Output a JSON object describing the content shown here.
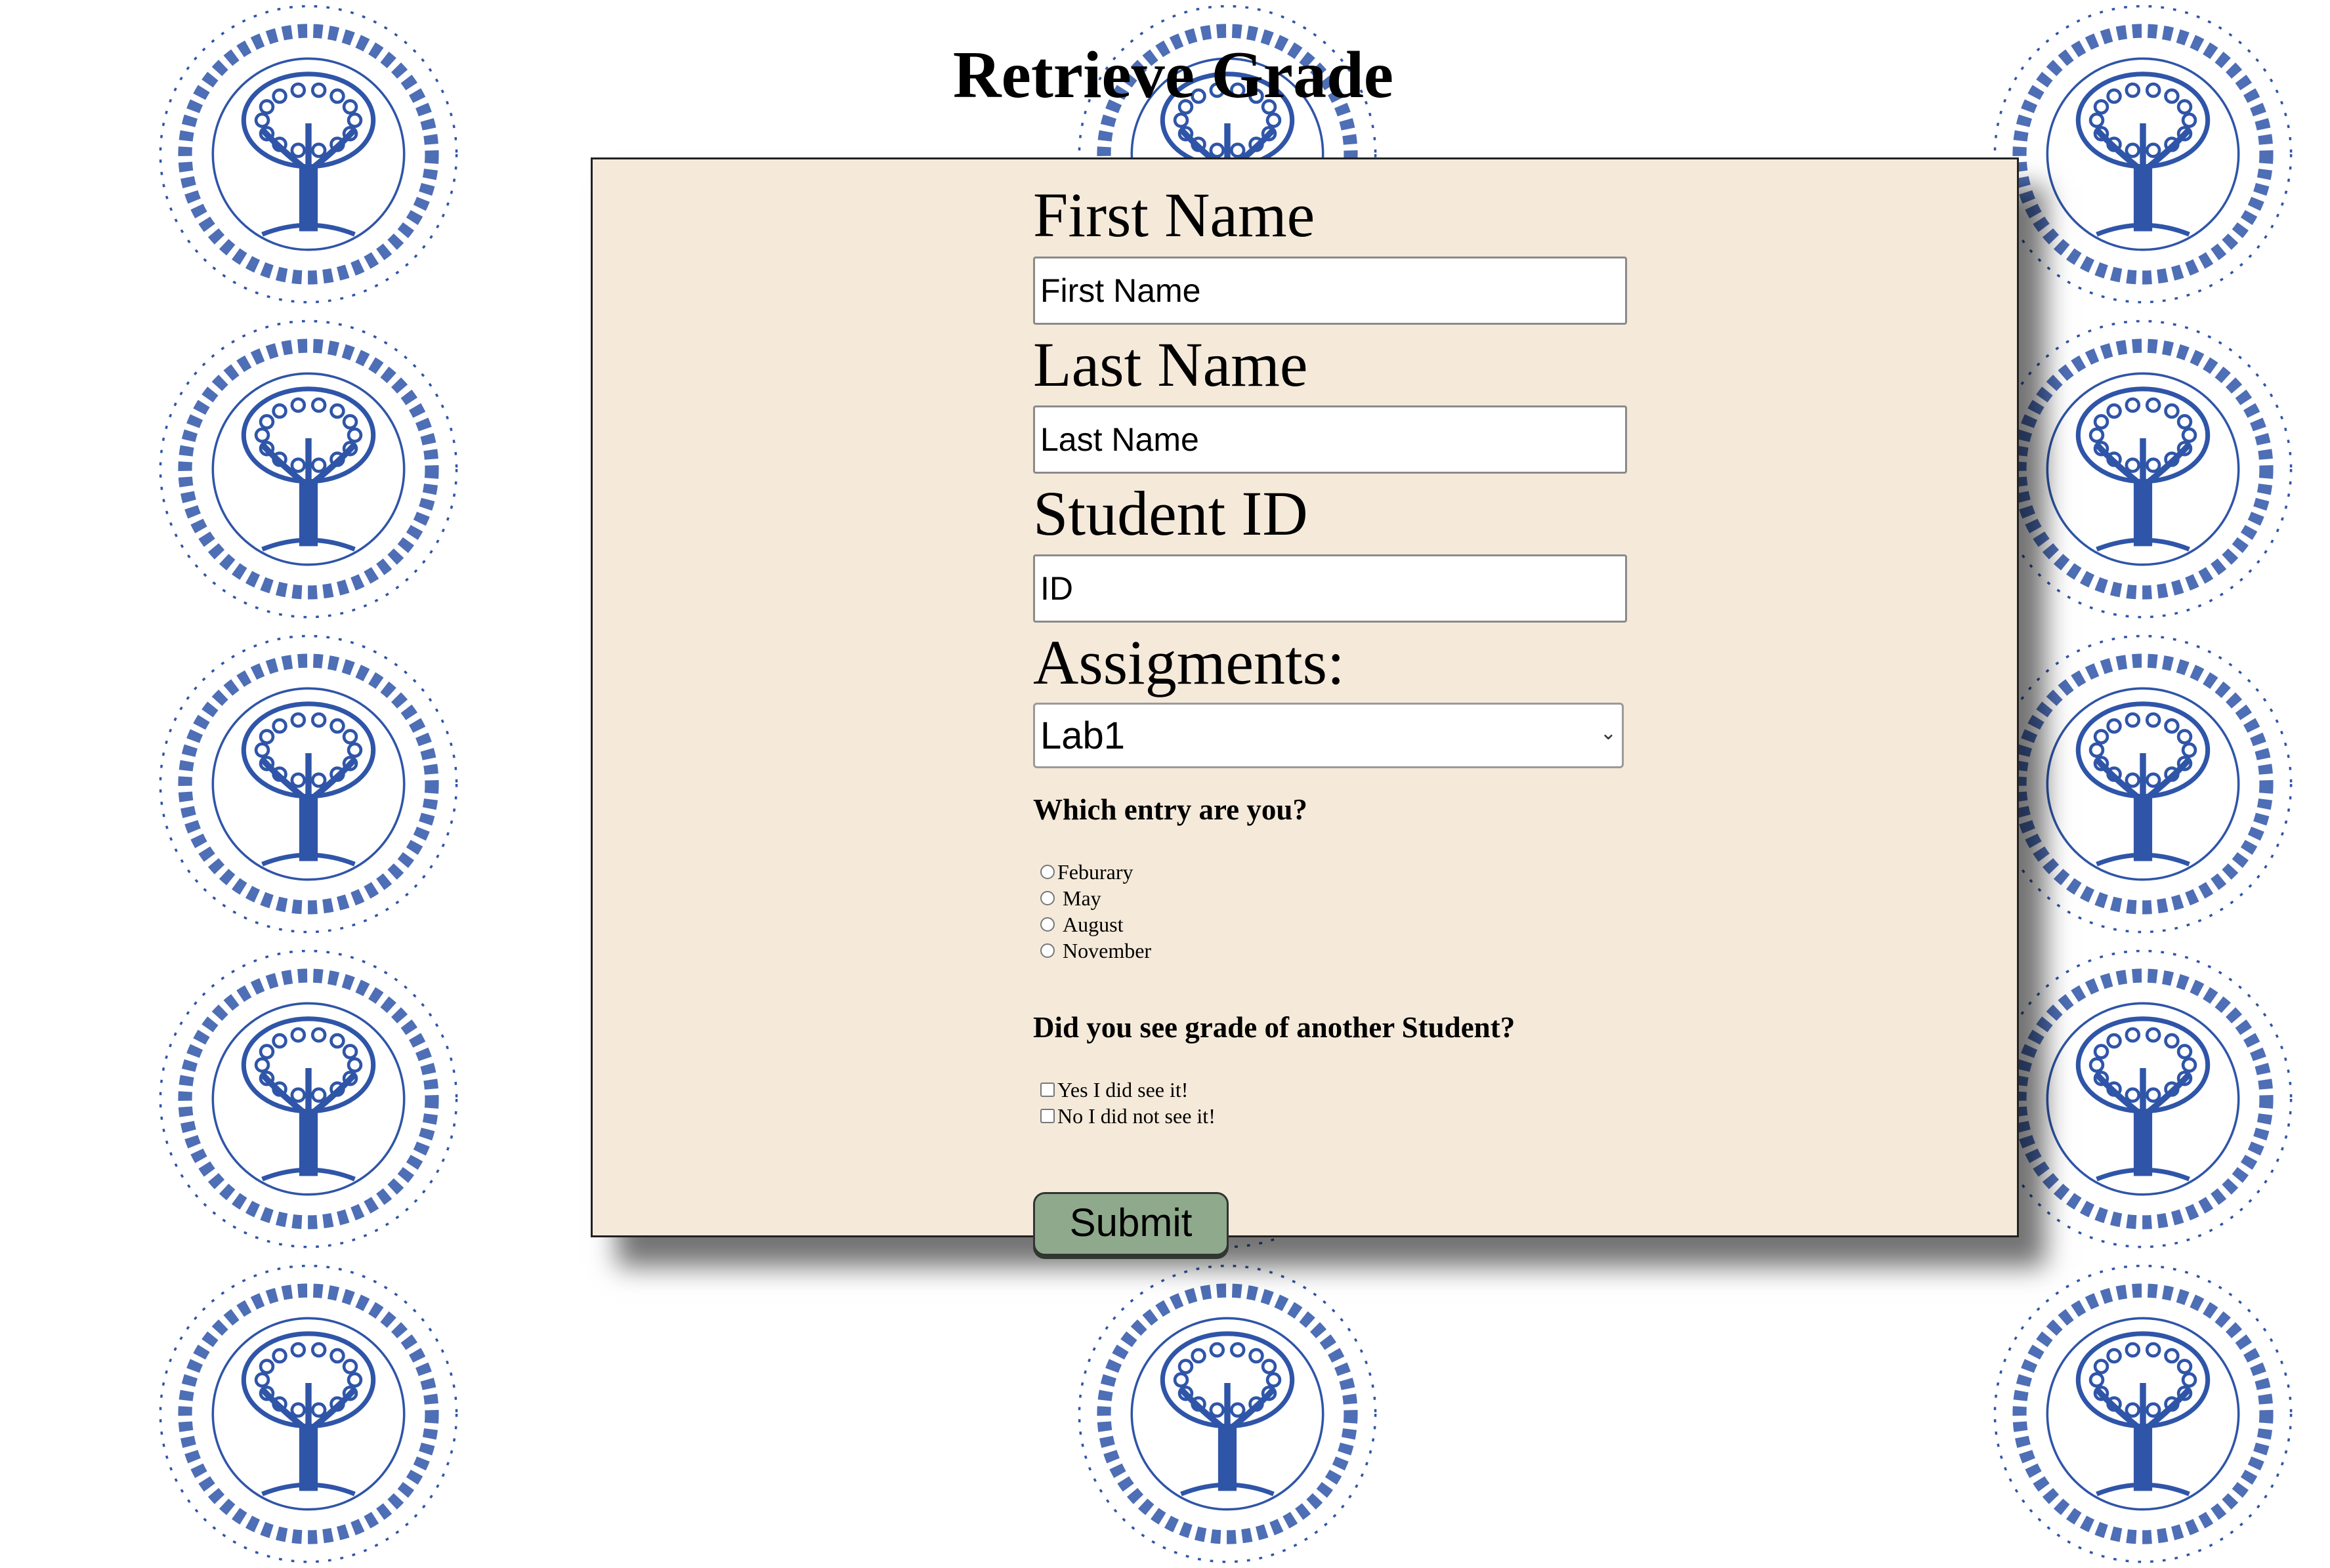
{
  "page_title": "Retrieve Grade",
  "background": {
    "watermark_icon": "university-seal-icon",
    "watermark_color": "#2f55a8"
  },
  "form": {
    "first_name": {
      "label": "First Name",
      "placeholder": "First Name"
    },
    "last_name": {
      "label": "Last Name",
      "placeholder": "Last Name"
    },
    "student_id": {
      "label": "Student ID",
      "placeholder": "ID"
    },
    "assignments": {
      "label": "Assigments:",
      "selected": "Lab1"
    },
    "entry": {
      "question": "Which entry are you?",
      "options": [
        "Feburary",
        "May",
        "August",
        "November"
      ]
    },
    "seen_grade": {
      "question": "Did you see grade of another Student?",
      "options": [
        "Yes I did see it!",
        "No I did not see it!"
      ]
    },
    "submit_label": "Submit"
  },
  "colors": {
    "panel_bg": "#f5eada",
    "submit_bg": "#8fa98c"
  }
}
